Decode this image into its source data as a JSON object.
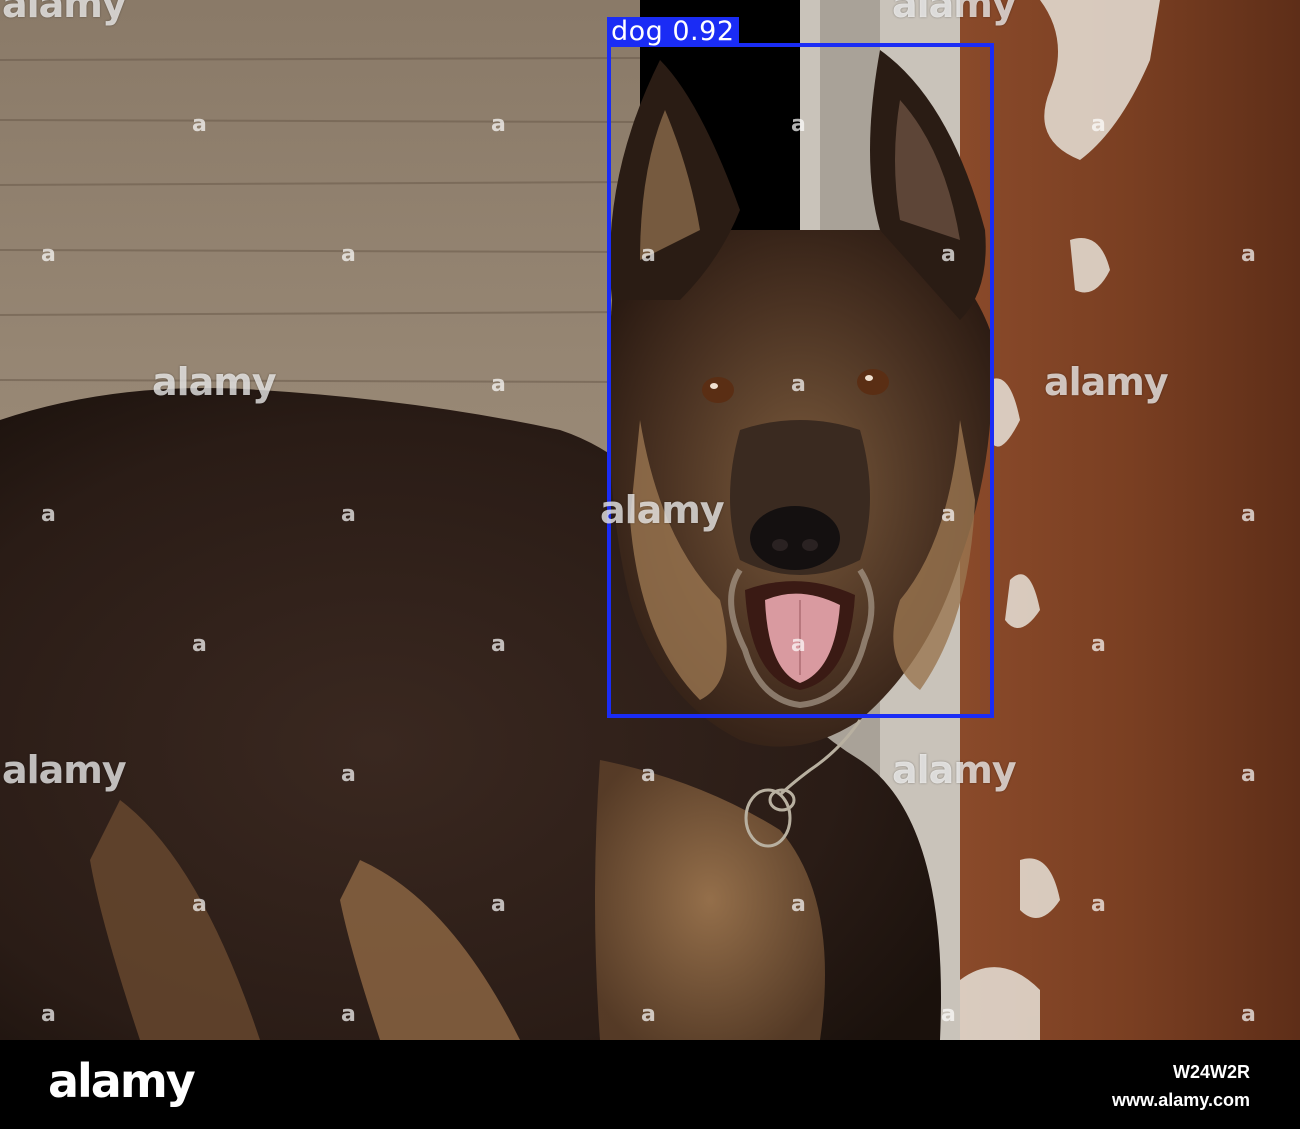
{
  "detection": {
    "label": "dog 0.92",
    "class": "dog",
    "confidence": 0.92,
    "box_color": "#1a2cf5"
  },
  "watermark": {
    "brand": "alamy",
    "small_mark": "a"
  },
  "footer": {
    "logo": "alamy",
    "image_id": "W24W2R",
    "url": "www.alamy.com"
  }
}
